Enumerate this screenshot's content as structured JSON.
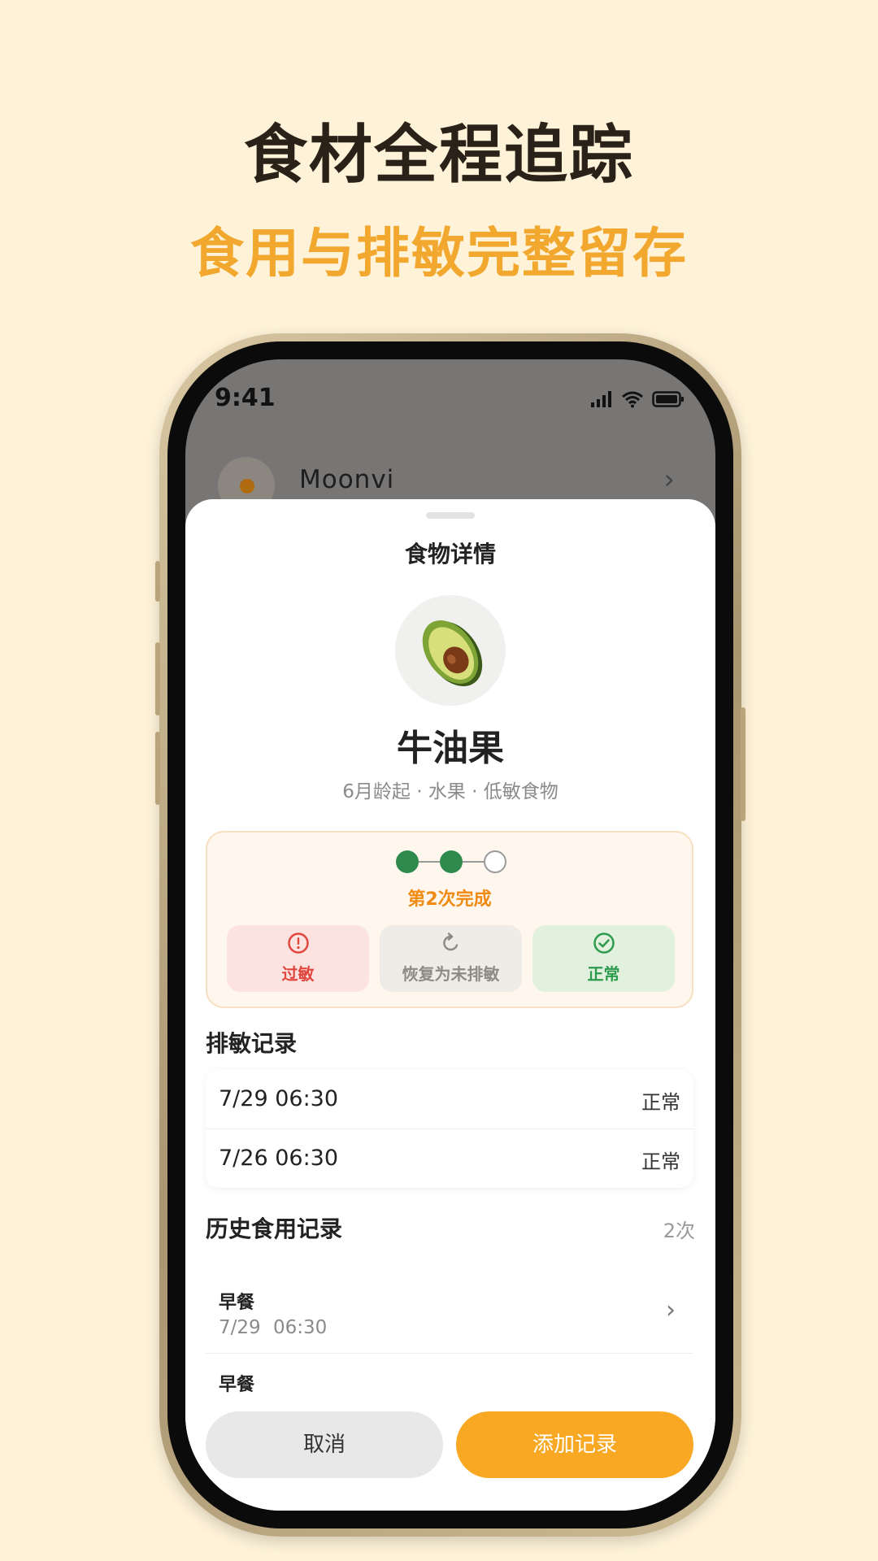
{
  "promo": {
    "headline": "食材全程追踪",
    "subline": "食用与排敏完整留存"
  },
  "status_bar": {
    "time": "9:41",
    "icons": [
      "signal-icon",
      "wifi-icon",
      "battery-icon"
    ]
  },
  "background_profile": {
    "name": "Moonvi"
  },
  "sheet": {
    "title": "食物详情",
    "food": {
      "icon": "avocado-icon",
      "name": "牛油果",
      "meta": "6月龄起 · 水果 · 低敏食物"
    },
    "progress": {
      "completed": 2,
      "total": 3,
      "label": "第2次完成"
    },
    "status_buttons": [
      {
        "label": "过敏",
        "icon": "alert-circle-icon",
        "color": "#E0463E"
      },
      {
        "label": "恢复为未排敏",
        "icon": "refresh-icon",
        "color": "#8e8a85"
      },
      {
        "label": "正常",
        "icon": "check-circle-icon",
        "color": "#2D9A4E"
      }
    ],
    "allergy_records": {
      "title": "排敏记录",
      "rows": [
        {
          "datetime": "7/29 06:30",
          "status": "正常"
        },
        {
          "datetime": "7/26 06:30",
          "status": "正常"
        }
      ]
    },
    "history": {
      "title": "历史食用记录",
      "count": "2次",
      "items": [
        {
          "meal": "早餐",
          "date": "7/29",
          "time": "06:30"
        },
        {
          "meal": "早餐",
          "date": "",
          "time": ""
        }
      ]
    },
    "actions": {
      "cancel": "取消",
      "add": "添加记录"
    }
  },
  "colors": {
    "page_bg": "#FEF3D9",
    "accent": "#F9A823",
    "progress_done": "#2D8A4C"
  }
}
